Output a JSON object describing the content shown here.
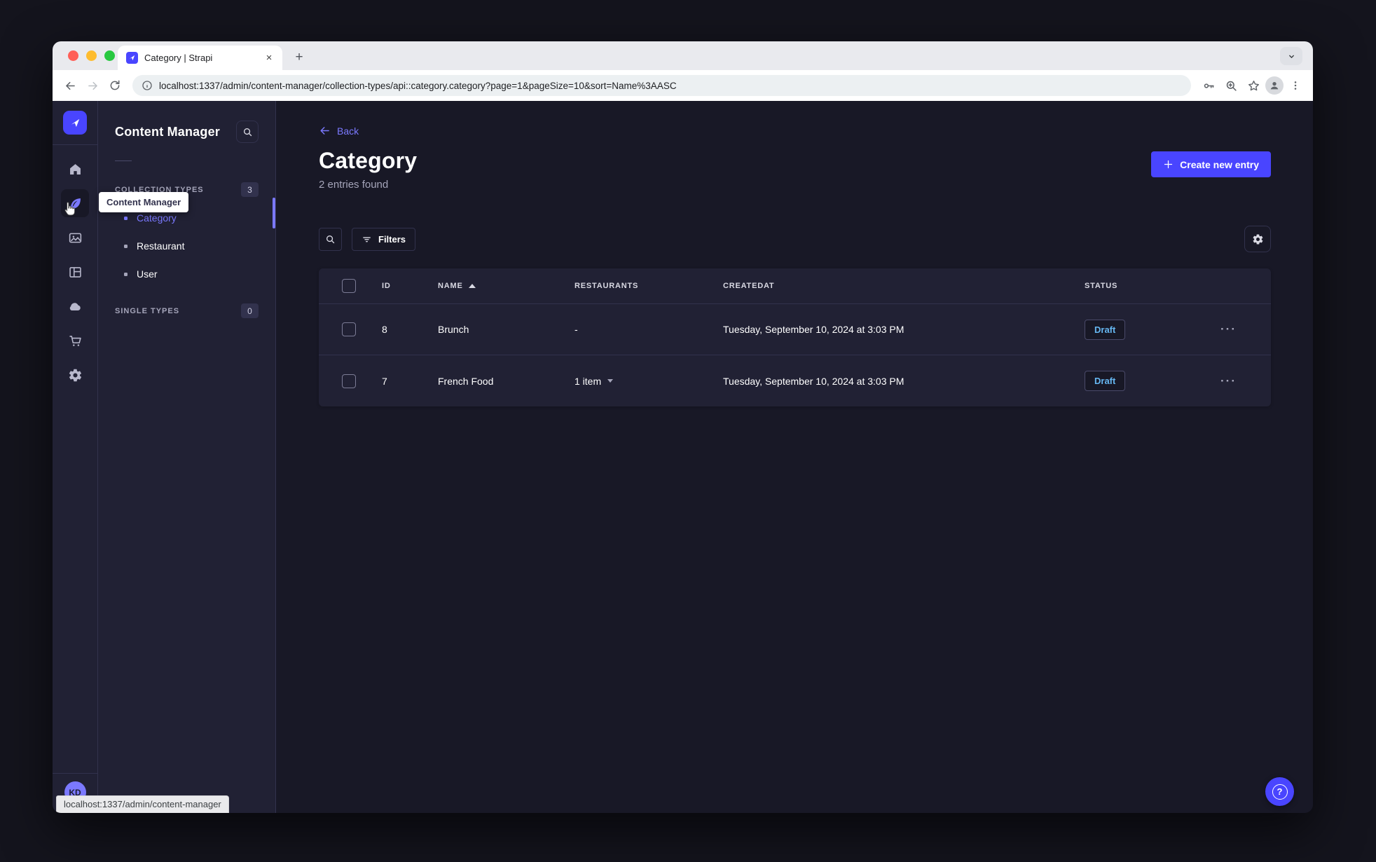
{
  "browser": {
    "tab_title": "Category | Strapi",
    "close_glyph": "×",
    "newtab_glyph": "+",
    "url": "localhost:1337/admin/content-manager/collection-types/api::category.category?page=1&pageSize=10&sort=Name%3AASC",
    "status_bar_text": "localhost:1337/admin/content-manager"
  },
  "sidebar": {
    "tooltip": "Content Manager",
    "avatar_initials": "KD",
    "help_glyph": "?"
  },
  "subnav": {
    "title": "Content Manager",
    "collection_types": {
      "label": "COLLECTION TYPES",
      "badge": "3",
      "items": [
        {
          "label": "Category",
          "active": true
        },
        {
          "label": "Restaurant",
          "active": false
        },
        {
          "label": "User",
          "active": false
        }
      ]
    },
    "single_types": {
      "label": "SINGLE TYPES",
      "badge": "0"
    }
  },
  "main": {
    "back_label": "Back",
    "title": "Category",
    "subtitle": "2 entries found",
    "create_button_label": "Create new entry",
    "filters_label": "Filters",
    "row_menu_glyph": "···",
    "table": {
      "columns": {
        "id": "ID",
        "name": "NAME",
        "restaurants": "RESTAURANTS",
        "createdat": "CREATEDAT",
        "status": "STATUS"
      },
      "rows": [
        {
          "id": "8",
          "name": "Brunch",
          "restaurants": "-",
          "createdat": "Tuesday, September 10, 2024 at 3:03 PM",
          "status": "Draft"
        },
        {
          "id": "7",
          "name": "French Food",
          "restaurants": "1 item",
          "createdat": "Tuesday, September 10, 2024 at 3:03 PM",
          "status": "Draft"
        }
      ]
    }
  },
  "colors": {
    "primary": "#4945ff",
    "primary_light": "#7b79ff",
    "draft_status": "#66b7f1",
    "app_bg": "#181826",
    "surface": "#212134",
    "border": "#32324d"
  }
}
